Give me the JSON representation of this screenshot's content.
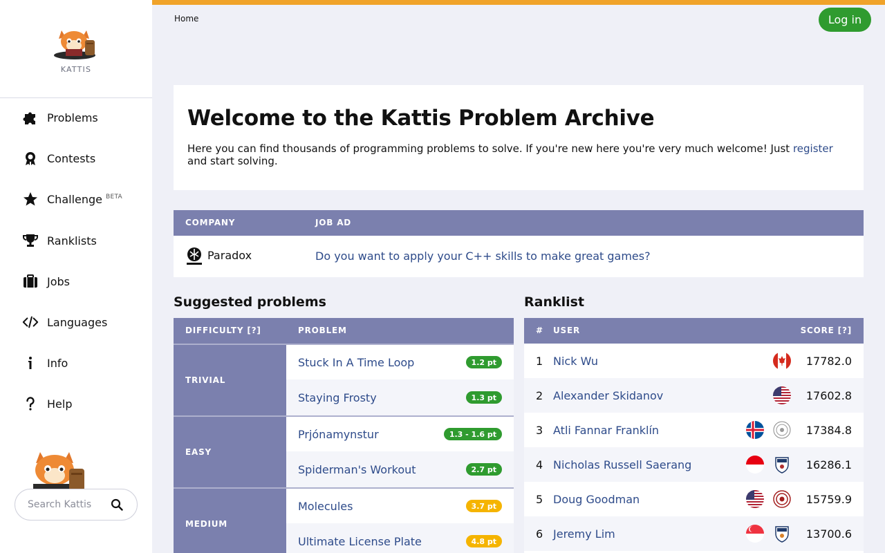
{
  "brand": {
    "name": "KATTIS"
  },
  "nav": [
    {
      "label": "Problems",
      "icon": "puzzle-icon"
    },
    {
      "label": "Contests",
      "icon": "medal-icon"
    },
    {
      "label": "Challenge",
      "icon": "star-icon",
      "badge": "BETA"
    },
    {
      "label": "Ranklists",
      "icon": "trophy-icon"
    },
    {
      "label": "Jobs",
      "icon": "briefcase-icon"
    },
    {
      "label": "Languages",
      "icon": "code-icon"
    },
    {
      "label": "Info",
      "icon": "info-icon"
    },
    {
      "label": "Help",
      "icon": "help-icon"
    }
  ],
  "search": {
    "placeholder": "Search Kattis"
  },
  "breadcrumb": "Home",
  "login_label": "Log in",
  "welcome": {
    "title": "Welcome to the Kattis Problem Archive",
    "text_before": "Here you can find thousands of programming problems to solve. If you're new here you're very much welcome! Just ",
    "link": "register",
    "text_after": " and start solving."
  },
  "jobs": {
    "headers": [
      "COMPANY",
      "JOB AD"
    ],
    "rows": [
      {
        "company": "Paradox",
        "ad": "Do you want to apply your C++ skills to make great games?"
      }
    ]
  },
  "suggested": {
    "title": "Suggested problems",
    "headers": [
      "DIFFICULTY [?]",
      "PROBLEM"
    ],
    "groups": [
      {
        "label": "TRIVIAL",
        "problems": [
          {
            "name": "Stuck In A Time Loop",
            "pt": "1.2 pt"
          },
          {
            "name": "Staying Frosty",
            "pt": "1.3 pt"
          }
        ]
      },
      {
        "label": "EASY",
        "problems": [
          {
            "name": "Prjónamynstur",
            "pt": "1.3 - 1.6 pt"
          },
          {
            "name": "Spiderman's Workout",
            "pt": "2.7 pt"
          }
        ]
      },
      {
        "label": "MEDIUM",
        "problems": [
          {
            "name": "Molecules",
            "pt": "3.7 pt"
          },
          {
            "name": "Ultimate License Plate",
            "pt": "4.8 pt"
          }
        ]
      }
    ]
  },
  "ranklist": {
    "title": "Ranklist",
    "headers": [
      "#",
      "USER",
      "SCORE [?]"
    ],
    "rows": [
      {
        "rank": "1",
        "user": "Nick Wu",
        "score": "17782.0"
      },
      {
        "rank": "2",
        "user": "Alexander Skidanov",
        "score": "17602.8"
      },
      {
        "rank": "3",
        "user": "Atli Fannar Franklín",
        "score": "17384.8"
      },
      {
        "rank": "4",
        "user": "Nicholas Russell Saerang",
        "score": "16286.1"
      },
      {
        "rank": "5",
        "user": "Doug Goodman",
        "score": "15759.9"
      },
      {
        "rank": "6",
        "user": "Jeremy Lim",
        "score": "13700.6"
      }
    ]
  },
  "colors": {
    "accent": "#f0a32a",
    "header": "#7b80ae",
    "trivial": "#2f9b2f",
    "medium": "#f5b400",
    "link": "#2e4b8a"
  }
}
